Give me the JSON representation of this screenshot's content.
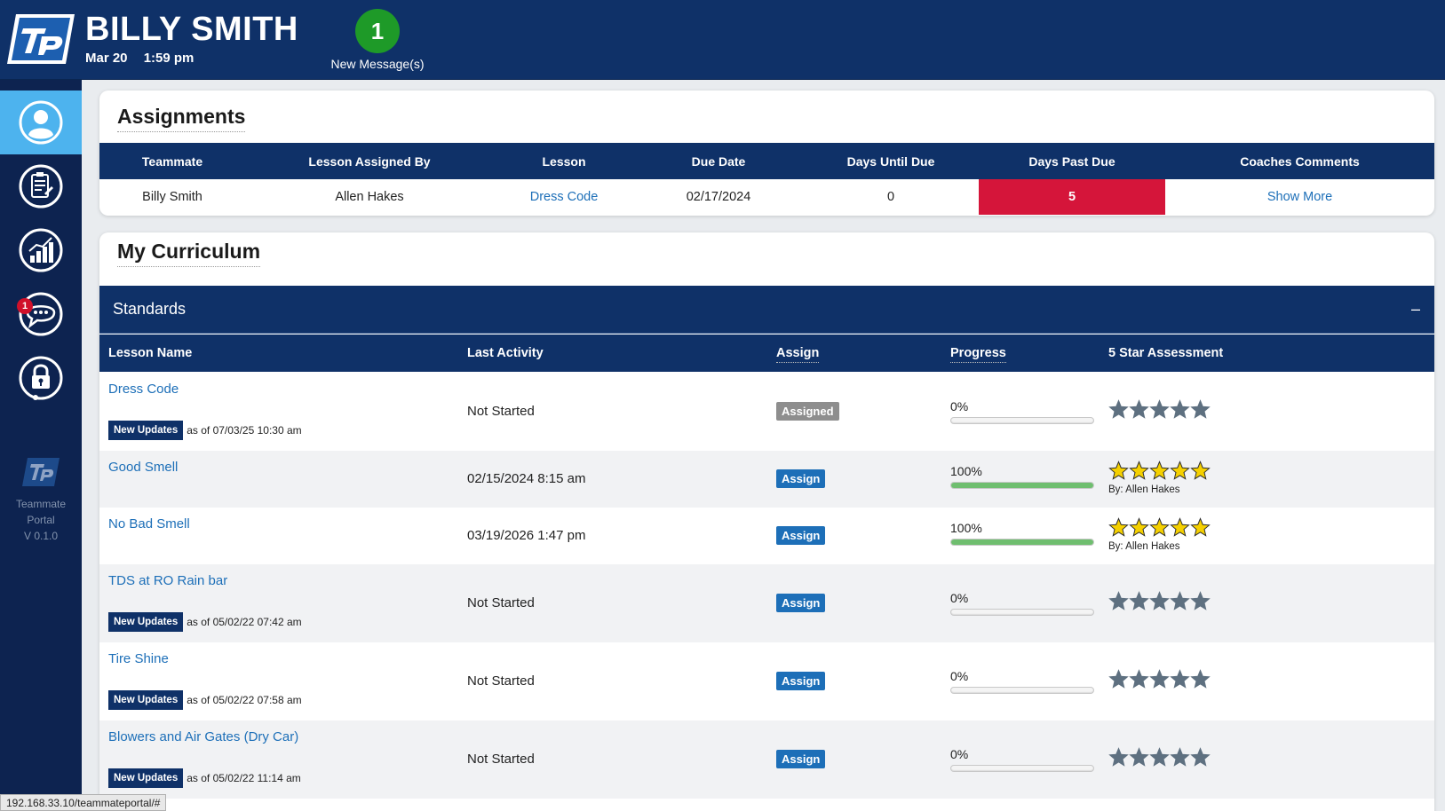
{
  "header": {
    "user_name": "BILLY SMITH",
    "date": "Mar 20",
    "time": "1:59 pm",
    "message_count": "1",
    "message_label": "New Message(s)"
  },
  "sidebar": {
    "items": [
      {
        "icon": "profile-icon",
        "active": true
      },
      {
        "icon": "clipboard-icon"
      },
      {
        "icon": "chart-icon"
      },
      {
        "icon": "chat-icon",
        "badge": "1"
      },
      {
        "icon": "lock-icon"
      }
    ],
    "footer_line1": "Teammate",
    "footer_line2": "Portal",
    "version": "V 0.1.0"
  },
  "assignments": {
    "title": "Assignments",
    "columns": [
      "Teammate",
      "Lesson Assigned By",
      "Lesson",
      "Due Date",
      "Days Until Due",
      "Days Past Due",
      "Coaches Comments"
    ],
    "rows": [
      {
        "teammate": "Billy Smith",
        "assigned_by": "Allen Hakes",
        "lesson": "Dress Code",
        "due_date": "02/17/2024",
        "days_until_due": "0",
        "days_past_due": "5",
        "comments": "Show More"
      }
    ]
  },
  "curriculum": {
    "title": "My Curriculum",
    "section": "Standards",
    "collapse_symbol": "–",
    "columns": {
      "lesson_name": "Lesson Name",
      "last_activity": "Last Activity",
      "assign": "Assign",
      "progress": "Progress",
      "assessment": "5 Star Assessment"
    },
    "rows": [
      {
        "name": "Dress Code",
        "updates_label": "New Updates",
        "updates_date": "as of 07/03/25 10:30 am",
        "last_activity": "Not Started",
        "assign_label": "Assigned",
        "progress_label": "0%",
        "progress": 0,
        "stars": 0,
        "by": ""
      },
      {
        "name": "Good Smell",
        "updates_label": "",
        "updates_date": "",
        "last_activity": "02/15/2024 8:15 am",
        "assign_label": "Assign",
        "progress_label": "100%",
        "progress": 100,
        "stars": 5,
        "by": "By: Allen Hakes"
      },
      {
        "name": "No Bad Smell",
        "updates_label": "",
        "updates_date": "",
        "last_activity": "03/19/2026 1:47 pm",
        "assign_label": "Assign",
        "progress_label": "100%",
        "progress": 100,
        "stars": 5,
        "by": "By: Allen Hakes"
      },
      {
        "name": "TDS at RO Rain bar",
        "updates_label": "New Updates",
        "updates_date": "as of 05/02/22 07:42 am",
        "last_activity": "Not Started",
        "assign_label": "Assign",
        "progress_label": "0%",
        "progress": 0,
        "stars": 0,
        "by": ""
      },
      {
        "name": "Tire Shine",
        "updates_label": "New Updates",
        "updates_date": "as of 05/02/22 07:58 am",
        "last_activity": "Not Started",
        "assign_label": "Assign",
        "progress_label": "0%",
        "progress": 0,
        "stars": 0,
        "by": ""
      },
      {
        "name": "Blowers and Air Gates (Dry Car)",
        "updates_label": "New Updates",
        "updates_date": "as of 05/02/22 11:14 am",
        "last_activity": "Not Started",
        "assign_label": "Assign",
        "progress_label": "0%",
        "progress": 0,
        "stars": 0,
        "by": ""
      }
    ]
  },
  "status_bar": "192.168.33.10/teammateportal/#",
  "colors": {
    "navy": "#0f3168",
    "sidebar": "#0d2350",
    "active": "#4db3ee",
    "past_due": "#d5153a",
    "link": "#1d6fb8",
    "message_green": "#1e9a28",
    "progress_green": "#6fbe6f",
    "star_gold": "#f5d000",
    "star_gray": "#5e7080"
  }
}
